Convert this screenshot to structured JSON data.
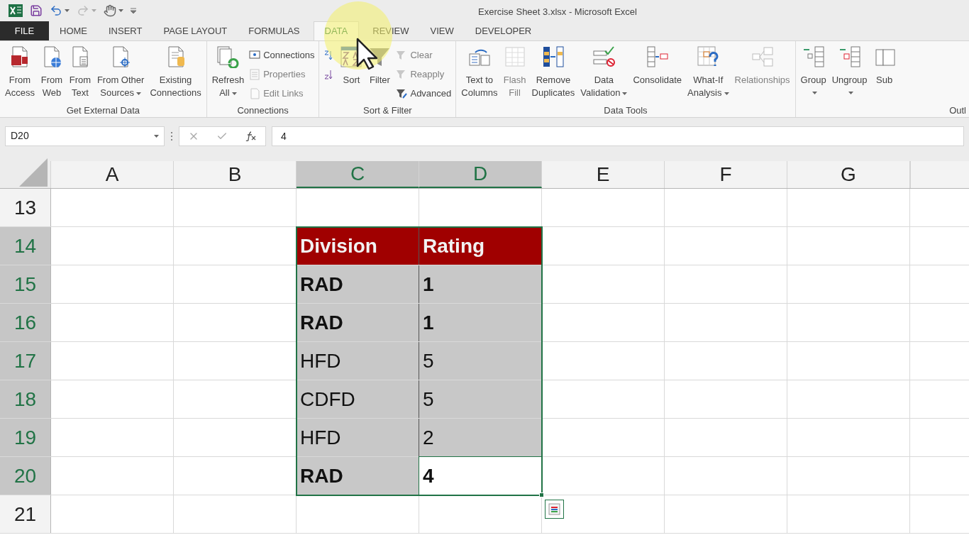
{
  "window": {
    "title": "Exercise Sheet 3.xlsx - Microsoft Excel"
  },
  "tabs": [
    {
      "label": "FILE",
      "kind": "file",
      "selected": false
    },
    {
      "label": "HOME",
      "kind": "tab",
      "selected": false
    },
    {
      "label": "INSERT",
      "kind": "tab",
      "selected": false
    },
    {
      "label": "PAGE LAYOUT",
      "kind": "tab",
      "selected": false
    },
    {
      "label": "FORMULAS",
      "kind": "tab",
      "selected": false
    },
    {
      "label": "DATA",
      "kind": "tab",
      "selected": true
    },
    {
      "label": "REVIEW",
      "kind": "tab",
      "selected": false
    },
    {
      "label": "VIEW",
      "kind": "tab",
      "selected": false
    },
    {
      "label": "DEVELOPER",
      "kind": "tab",
      "selected": false
    }
  ],
  "ribbon": {
    "groups": [
      {
        "label": "Get External Data",
        "items": [
          {
            "kind": "large",
            "lines": [
              "From",
              "Access"
            ],
            "dropdown": false,
            "disabled": false
          },
          {
            "kind": "large",
            "lines": [
              "From",
              "Web"
            ],
            "dropdown": false,
            "disabled": false
          },
          {
            "kind": "large",
            "lines": [
              "From",
              "Text"
            ],
            "dropdown": false,
            "disabled": false
          },
          {
            "kind": "large",
            "lines": [
              "From Other",
              "Sources"
            ],
            "dropdown": true,
            "disabled": false
          },
          {
            "kind": "large",
            "lines": [
              "Existing",
              "Connections"
            ],
            "dropdown": false,
            "disabled": false
          }
        ]
      },
      {
        "label": "Connections",
        "items": [
          {
            "kind": "large",
            "lines": [
              "Refresh",
              "All"
            ],
            "dropdown": true,
            "disabled": false
          },
          {
            "kind": "stack",
            "entries": [
              {
                "label": "Connections",
                "disabled": false
              },
              {
                "label": "Properties",
                "disabled": true
              },
              {
                "label": "Edit Links",
                "disabled": true
              }
            ]
          }
        ]
      },
      {
        "label": "Sort & Filter",
        "items": [
          {
            "kind": "stack",
            "entries": [
              {
                "disabled": false
              },
              {
                "disabled": false
              }
            ]
          },
          {
            "kind": "large",
            "lines": [
              "Sort"
            ],
            "dropdown": false,
            "disabled": false
          },
          {
            "kind": "large",
            "lines": [
              "Filter"
            ],
            "dropdown": false,
            "disabled": false
          },
          {
            "kind": "stack",
            "entries": [
              {
                "label": "Clear",
                "disabled": true
              },
              {
                "label": "Reapply",
                "disabled": true
              },
              {
                "label": "Advanced",
                "disabled": false
              }
            ]
          }
        ]
      },
      {
        "label": "Data Tools",
        "items": [
          {
            "kind": "large",
            "lines": [
              "Text to",
              "Columns"
            ],
            "dropdown": false,
            "disabled": false
          },
          {
            "kind": "large",
            "lines": [
              "Flash",
              "Fill"
            ],
            "dropdown": false,
            "disabled": true
          },
          {
            "kind": "large",
            "lines": [
              "Remove",
              "Duplicates"
            ],
            "dropdown": false,
            "disabled": false
          },
          {
            "kind": "large",
            "lines": [
              "Data",
              "Validation"
            ],
            "dropdown": true,
            "disabled": false
          },
          {
            "kind": "large",
            "lines": [
              "Consolidate"
            ],
            "dropdown": false,
            "disabled": false
          },
          {
            "kind": "large",
            "lines": [
              "What-If",
              "Analysis"
            ],
            "dropdown": true,
            "disabled": false
          },
          {
            "kind": "large",
            "lines": [
              "Relationships"
            ],
            "dropdown": false,
            "disabled": true
          }
        ]
      },
      {
        "label": "Outl",
        "items": [
          {
            "kind": "large",
            "lines": [
              "Group"
            ],
            "dropdown": true,
            "disabled": false
          },
          {
            "kind": "large",
            "lines": [
              "Ungroup"
            ],
            "dropdown": true,
            "disabled": false
          },
          {
            "kind": "large",
            "lines": [
              "Sub"
            ],
            "dropdown": false,
            "disabled": false
          }
        ]
      }
    ]
  },
  "formula_bar": {
    "name_box": "D20",
    "formula": "4"
  },
  "sheet": {
    "columns": [
      {
        "label": "A",
        "selected": false
      },
      {
        "label": "B",
        "selected": false
      },
      {
        "label": "C",
        "selected": true
      },
      {
        "label": "D",
        "selected": true
      },
      {
        "label": "E",
        "selected": false
      },
      {
        "label": "F",
        "selected": false
      },
      {
        "label": "G",
        "selected": false
      }
    ],
    "rows": [
      {
        "number": "13",
        "selected": false,
        "cells": [
          {},
          {},
          {},
          {},
          {},
          {},
          {}
        ]
      },
      {
        "number": "14",
        "selected": true,
        "cells": [
          {},
          {},
          {
            "text": "Division",
            "kind": "header"
          },
          {
            "text": "Rating",
            "kind": "header"
          },
          {},
          {},
          {}
        ]
      },
      {
        "number": "15",
        "selected": true,
        "cells": [
          {},
          {},
          {
            "text": "RAD",
            "kind": "data",
            "bold": true,
            "selected": true,
            "active": false
          },
          {
            "text": "1",
            "kind": "data",
            "bold": true,
            "selected": true,
            "active": false
          },
          {},
          {},
          {}
        ]
      },
      {
        "number": "16",
        "selected": true,
        "cells": [
          {},
          {},
          {
            "text": "RAD",
            "kind": "data",
            "bold": true,
            "selected": true,
            "active": false
          },
          {
            "text": "1",
            "kind": "data",
            "bold": true,
            "selected": true,
            "active": false
          },
          {},
          {},
          {}
        ]
      },
      {
        "number": "17",
        "selected": true,
        "cells": [
          {},
          {},
          {
            "text": "HFD",
            "kind": "data",
            "bold": false,
            "selected": true,
            "active": false
          },
          {
            "text": "5",
            "kind": "data",
            "bold": false,
            "selected": true,
            "active": false
          },
          {},
          {},
          {}
        ]
      },
      {
        "number": "18",
        "selected": true,
        "cells": [
          {},
          {},
          {
            "text": "CDFD",
            "kind": "data",
            "bold": false,
            "selected": true,
            "active": false
          },
          {
            "text": "5",
            "kind": "data",
            "bold": false,
            "selected": true,
            "active": false
          },
          {},
          {},
          {}
        ]
      },
      {
        "number": "19",
        "selected": true,
        "cells": [
          {},
          {},
          {
            "text": "HFD",
            "kind": "data",
            "bold": false,
            "selected": true,
            "active": false
          },
          {
            "text": "2",
            "kind": "data",
            "bold": false,
            "selected": true,
            "active": false
          },
          {},
          {},
          {}
        ]
      },
      {
        "number": "20",
        "selected": true,
        "cells": [
          {},
          {},
          {
            "text": "RAD",
            "kind": "data",
            "bold": true,
            "selected": true,
            "active": false
          },
          {
            "text": "4",
            "kind": "data",
            "bold": true,
            "active": true
          },
          {},
          {},
          {}
        ]
      },
      {
        "number": "21",
        "selected": false,
        "cells": [
          {},
          {},
          {},
          {},
          {},
          {},
          {}
        ]
      }
    ]
  }
}
